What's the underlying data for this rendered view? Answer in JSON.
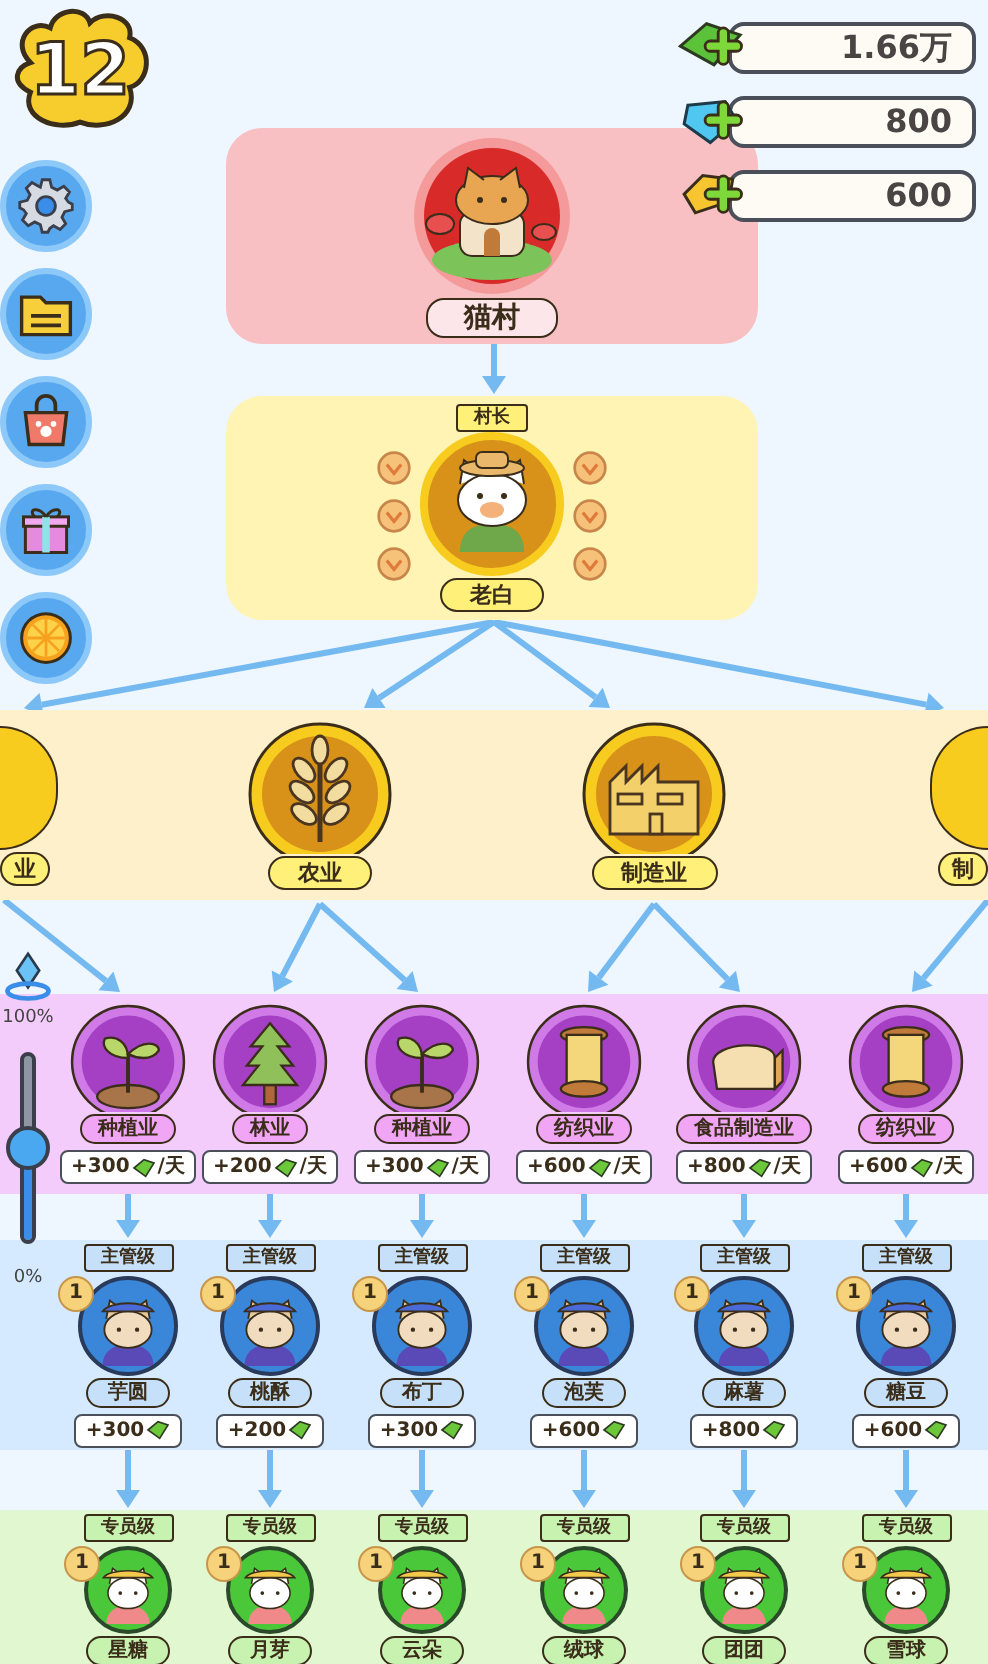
{
  "level_badge": "12",
  "sidebar": [
    {
      "kind": "settings"
    },
    {
      "kind": "folder"
    },
    {
      "kind": "shop"
    },
    {
      "kind": "gift"
    },
    {
      "kind": "orange"
    }
  ],
  "currencies": [
    {
      "kind": "cash",
      "amount": "1.66万"
    },
    {
      "kind": "gem",
      "amount": "800"
    },
    {
      "kind": "gold",
      "amount": "600"
    }
  ],
  "village": {
    "name": "猫村"
  },
  "chief": {
    "title": "村长",
    "name": "老白"
  },
  "sectors": [
    {
      "kind": "partial-left",
      "label": "业"
    },
    {
      "kind": "wheat",
      "label": "农业"
    },
    {
      "kind": "factory",
      "label": "制造业"
    },
    {
      "kind": "partial-right",
      "label": "制"
    }
  ],
  "industries": [
    {
      "kind": "sprout",
      "label": "种植业",
      "income": "+300",
      "unit": "/天"
    },
    {
      "kind": "tree",
      "label": "林业",
      "income": "+200",
      "unit": "/天"
    },
    {
      "kind": "sprout",
      "label": "种植业",
      "income": "+300",
      "unit": "/天"
    },
    {
      "kind": "spool",
      "label": "纺织业",
      "income": "+600",
      "unit": "/天"
    },
    {
      "kind": "bread",
      "label": "食品制造业",
      "income": "+800",
      "unit": "/天"
    },
    {
      "kind": "spool",
      "label": "纺织业",
      "income": "+600",
      "unit": "/天"
    }
  ],
  "managers": [
    {
      "rank_title": "主管级",
      "badge": "1",
      "name": "芋圆",
      "income": "+300"
    },
    {
      "rank_title": "主管级",
      "badge": "1",
      "name": "桃酥",
      "income": "+200"
    },
    {
      "rank_title": "主管级",
      "badge": "1",
      "name": "布丁",
      "income": "+300"
    },
    {
      "rank_title": "主管级",
      "badge": "1",
      "name": "泡芙",
      "income": "+600"
    },
    {
      "rank_title": "主管级",
      "badge": "1",
      "name": "麻薯",
      "income": "+800"
    },
    {
      "rank_title": "主管级",
      "badge": "1",
      "name": "糖豆",
      "income": "+600"
    }
  ],
  "staff": [
    {
      "rank_title": "专员级",
      "badge": "1",
      "name": "星糖"
    },
    {
      "rank_title": "专员级",
      "badge": "1",
      "name": "月芽"
    },
    {
      "rank_title": "专员级",
      "badge": "1",
      "name": "云朵"
    },
    {
      "rank_title": "专员级",
      "badge": "1",
      "name": "绒球"
    },
    {
      "rank_title": "专员级",
      "badge": "1",
      "name": "团团"
    },
    {
      "rank_title": "专员级",
      "badge": "1",
      "name": "雪球"
    }
  ],
  "zoom_slider": {
    "top_label": "100%",
    "bottom_label": "0%",
    "level": 0.5
  }
}
